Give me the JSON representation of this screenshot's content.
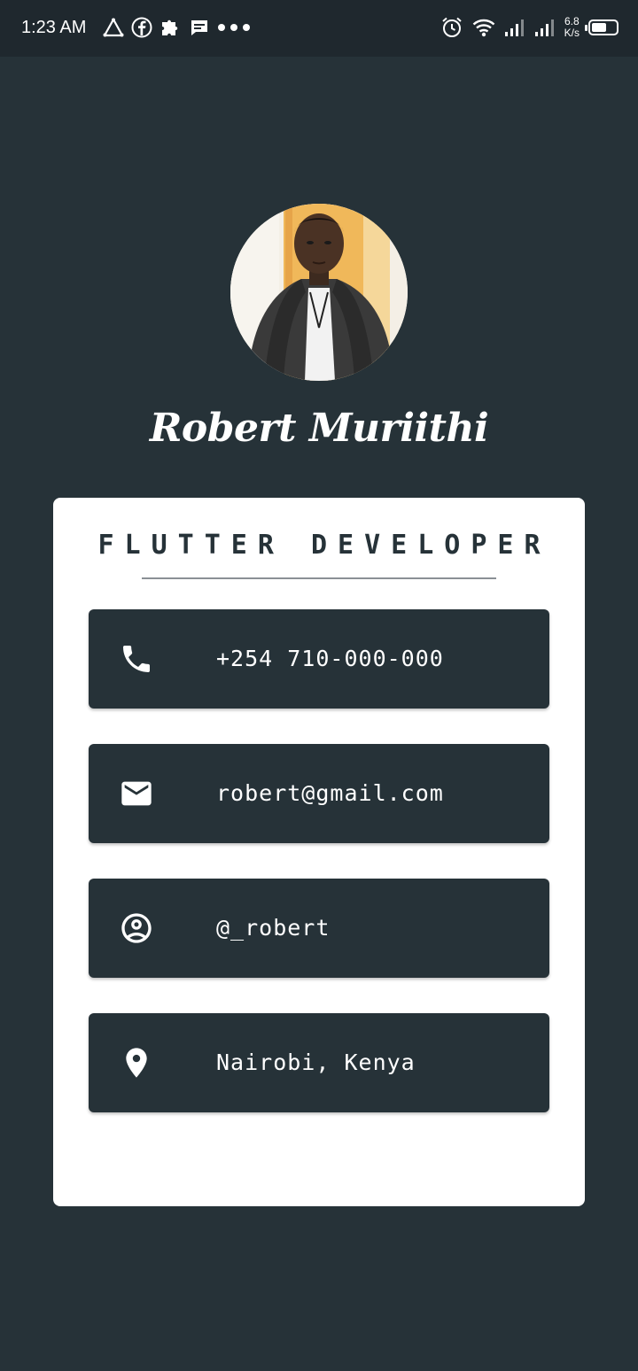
{
  "status_bar": {
    "time": "1:23 AM",
    "left_icons": [
      "notification-triangle-icon",
      "facebook-icon",
      "puzzle-icon",
      "message-icon",
      "more-dots-icon"
    ],
    "right_icons": [
      "alarm-icon",
      "wifi-icon",
      "signal-icon",
      "signal-icon"
    ],
    "speed_value": "6.8",
    "speed_unit": "K/s",
    "battery_level": 0.6
  },
  "profile": {
    "name": "Robert Muriithi",
    "role": "FLUTTER DEVELOPER",
    "avatar": "profile-photo"
  },
  "contacts": [
    {
      "icon": "phone-icon",
      "text": "+254 710-000-000"
    },
    {
      "icon": "email-icon",
      "text": "robert@gmail.com"
    },
    {
      "icon": "account-circle-icon",
      "text": "@_robert"
    },
    {
      "icon": "location-pin-icon",
      "text": "Nairobi, Kenya"
    }
  ],
  "colors": {
    "background": "#263238",
    "card": "#ffffff",
    "tile": "#263238",
    "text_light": "#ffffff"
  }
}
